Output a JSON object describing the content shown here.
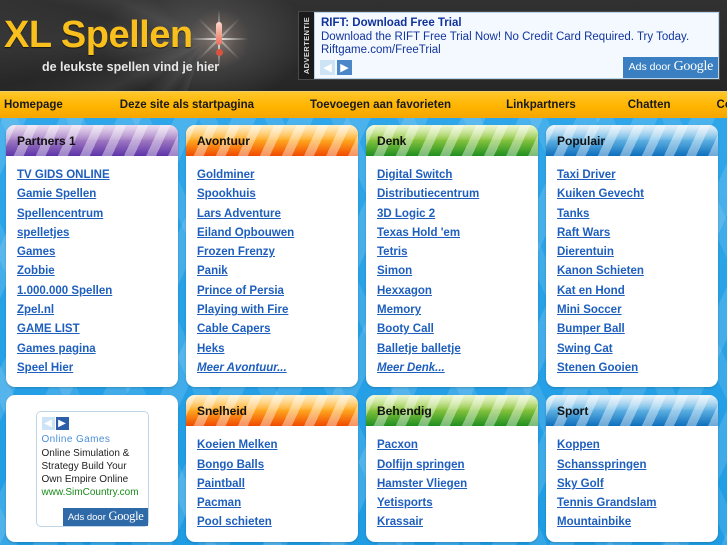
{
  "site": {
    "logo_title": "XL Spellen",
    "tagline": "de leukste spellen vind je hier"
  },
  "advertisement": {
    "label": "ADVERTENTIE",
    "headline": "RIFT: Download Free Trial",
    "description": "Download the RIFT Free Trial Now! No Credit Card Required. Try Today.",
    "url": "Riftgame.com/FreeTrial",
    "prev_arrow": "◀",
    "next_arrow": "▶",
    "attribution_prefix": "Ads door ",
    "attribution_brand": "Google"
  },
  "nav": {
    "items": [
      {
        "label": "Homepage"
      },
      {
        "label": "Deze site als startpagina"
      },
      {
        "label": "Toevoegen aan favorieten"
      },
      {
        "label": "Linkpartners"
      },
      {
        "label": "Chatten"
      },
      {
        "label": "Contact"
      }
    ]
  },
  "panels": [
    {
      "title": "Partners 1",
      "theme": "head-purple",
      "size": "tall",
      "links": [
        "TV GIDS ONLINE",
        "Gamie Spellen",
        "Spellencentrum",
        "spelletjes",
        "Games",
        "Zobbie",
        "1.000.000 Spellen",
        "Zpel.nl",
        "GAME LIST",
        "Games pagina",
        "Speel Hier"
      ],
      "more": null
    },
    {
      "title": "Avontuur",
      "theme": "head-orange",
      "size": "tall",
      "links": [
        "Goldminer",
        "Spookhuis",
        "Lars Adventure",
        "Eiland Opbouwen",
        "Frozen Frenzy",
        "Panik",
        "Prince of Persia",
        "Playing with Fire",
        "Cable Capers",
        "Heks"
      ],
      "more": "Meer Avontuur..."
    },
    {
      "title": "Denk",
      "theme": "head-green",
      "size": "tall",
      "links": [
        "Digital Switch",
        "Distributiecentrum",
        "3D Logic 2",
        "Texas Hold 'em",
        "Tetris",
        "Simon",
        "Hexxagon",
        "Memory",
        "Booty Call",
        "Balletje balletje"
      ],
      "more": "Meer Denk..."
    },
    {
      "title": "Populair",
      "theme": "head-blue",
      "size": "tall",
      "links": [
        "Taxi Driver",
        "Kuiken Gevecht",
        "Tanks",
        "Raft Wars",
        "Dierentuin",
        "Kanon Schieten",
        "Kat en Hond",
        "Mini Soccer",
        "Bumper Ball",
        "Swing Cat",
        "Stenen Gooien"
      ],
      "more": null
    },
    {
      "title": "Snelheid",
      "theme": "head-orange",
      "size": "short",
      "links": [
        "Koeien Melken",
        "Bongo Balls",
        "Paintball",
        "Pacman",
        "Pool schieten"
      ],
      "more": null
    },
    {
      "title": "Behendig",
      "theme": "head-green",
      "size": "short",
      "links": [
        "Pacxon",
        "Dolfijn springen",
        "Hamster Vliegen",
        "Yetisports",
        "Krassair"
      ],
      "more": null
    },
    {
      "title": "Sport",
      "theme": "head-blue",
      "size": "short",
      "links": [
        "Koppen",
        "Schansspringen",
        "Sky Golf",
        "Tennis Grandslam",
        "Mountainbike"
      ],
      "more": null
    }
  ],
  "sidebar_ad": {
    "prev_arrow": "◀",
    "next_arrow": "▶",
    "title": "Online Games",
    "description": "Online Simulation & Strategy Build Your Own Empire Online",
    "url": "www.SimCountry.com",
    "attribution_prefix": "Ads door ",
    "attribution_brand": "Google"
  },
  "colors": {
    "page_blue": "#2ba4e8",
    "nav_orange": "#ffb400",
    "logo_yellow": "#f9bf1c",
    "link_blue": "#1e5fbe",
    "header_dark": "#2b2b2b"
  }
}
